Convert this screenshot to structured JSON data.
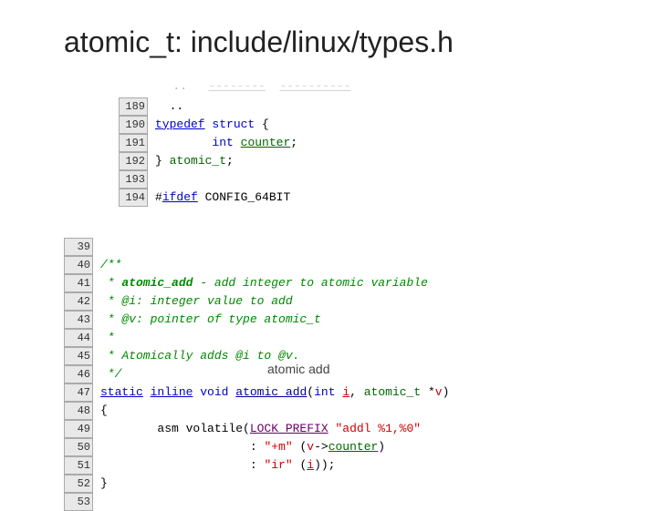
{
  "page": {
    "title": "atomic_t: include/linux/types.h"
  },
  "top_code": {
    "header_line": "  ..   --------  ----------",
    "lines": [
      {
        "num": "189",
        "code": "  .."
      },
      {
        "num": "190",
        "code": "typedef struct {"
      },
      {
        "num": "191",
        "code": "        int counter;"
      },
      {
        "num": "192",
        "code": "} atomic_t;"
      },
      {
        "num": "193",
        "code": ""
      },
      {
        "num": "194",
        "code": "#ifdef CONFIG_64BIT"
      }
    ]
  },
  "bottom_code": {
    "lines": [
      {
        "num": "39",
        "code": ""
      },
      {
        "num": "40",
        "code": "/**"
      },
      {
        "num": "41",
        "code": " * atomic_add - add integer to atomic variable"
      },
      {
        "num": "42",
        "code": " * @i: integer value to add"
      },
      {
        "num": "43",
        "code": " * @v: pointer of type atomic_t"
      },
      {
        "num": "44",
        "code": " *"
      },
      {
        "num": "45",
        "code": " * Atomically adds @i to @v."
      },
      {
        "num": "46",
        "code": " */"
      },
      {
        "num": "47",
        "code": "static inline void atomic_add(int i, atomic_t *v)"
      },
      {
        "num": "48",
        "code": "{"
      },
      {
        "num": "49",
        "code": "        asm volatile(LOCK_PREFIX \"addl %1,%0\""
      },
      {
        "num": "50",
        "code": "                     : \"+m\" (v->counter)"
      },
      {
        "num": "51",
        "code": "                     : \"ir\" (i));"
      },
      {
        "num": "52",
        "code": "}"
      },
      {
        "num": "53",
        "code": ""
      }
    ]
  },
  "labels": {
    "atomic_add_text": "atomic add"
  }
}
